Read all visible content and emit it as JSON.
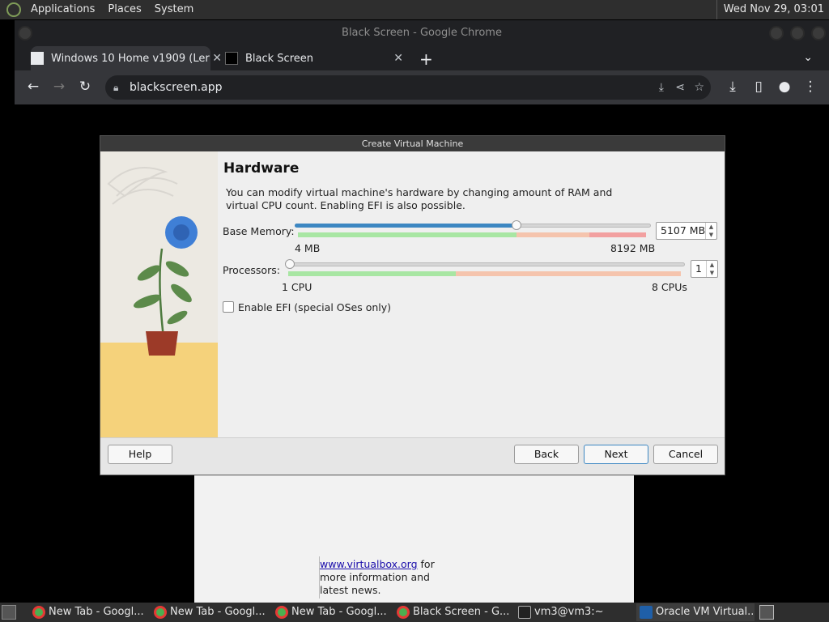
{
  "top_panel": {
    "menus": [
      "Applications",
      "Places",
      "System"
    ],
    "clock": "Wed Nov 29, 03:01"
  },
  "chrome": {
    "window_title": "Black Screen - Google Chrome",
    "tabs": [
      {
        "label": "Windows 10 Home v1909 (Ler",
        "active": true
      },
      {
        "label": "Black Screen",
        "active": false
      }
    ],
    "url": "blackscreen.app"
  },
  "background_window": {
    "link_text": "www.virtualbox.org",
    "note_after_link": "for more information and latest news."
  },
  "dialog": {
    "title": "Create Virtual Machine",
    "heading": "Hardware",
    "description": "You can modify virtual machine's hardware by changing amount of RAM and virtual CPU count. Enabling EFI is also possible.",
    "memory": {
      "label": "Base Memory:",
      "value": "5107 MB",
      "min_label": "4 MB",
      "max_label": "8192 MB",
      "min": 4,
      "max": 8192,
      "current": 5107
    },
    "processors": {
      "label": "Processors:",
      "value": "1",
      "min_label": "1 CPU",
      "max_label": "8 CPUs",
      "min": 1,
      "max": 8,
      "current": 1
    },
    "efi": {
      "label": "Enable EFI (special OSes only)",
      "checked": false
    },
    "buttons": {
      "help": "Help",
      "back": "Back",
      "next": "Next",
      "cancel": "Cancel"
    }
  },
  "taskbar": {
    "items": [
      {
        "label": "New Tab - Googl...",
        "icon": "chrome-icon"
      },
      {
        "label": "New Tab - Googl...",
        "icon": "chrome-icon"
      },
      {
        "label": "New Tab - Googl...",
        "icon": "chrome-icon"
      },
      {
        "label": "Black Screen - G...",
        "icon": "chrome-icon"
      },
      {
        "label": "vm3@vm3:~",
        "icon": "terminal-icon"
      },
      {
        "label": "Oracle VM Virtual...",
        "icon": "virtualbox-icon",
        "active": true
      }
    ]
  },
  "colors": {
    "accent": "#3d87c2",
    "slider_safe": "#a8e6a3",
    "slider_warn": "#f5b8a4",
    "slider_danger": "#f2a0a0"
  }
}
